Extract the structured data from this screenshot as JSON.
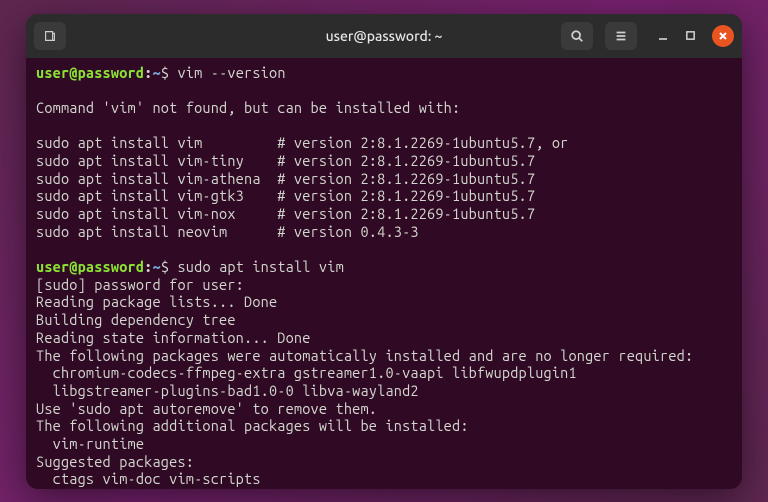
{
  "window": {
    "title": "user@password: ~"
  },
  "prompt": {
    "userhost": "user@password",
    "colon": ":",
    "path": "~",
    "symbol": "$"
  },
  "commands": {
    "cmd1": "vim --version",
    "cmd2": "sudo apt install vim"
  },
  "output": {
    "notfound": "Command 'vim' not found, but can be installed with:",
    "sugg1": "sudo apt install vim         # version 2:8.1.2269-1ubuntu5.7, or",
    "sugg2": "sudo apt install vim-tiny    # version 2:8.1.2269-1ubuntu5.7",
    "sugg3": "sudo apt install vim-athena  # version 2:8.1.2269-1ubuntu5.7",
    "sugg4": "sudo apt install vim-gtk3    # version 2:8.1.2269-1ubuntu5.7",
    "sugg5": "sudo apt install vim-nox     # version 2:8.1.2269-1ubuntu5.7",
    "sugg6": "sudo apt install neovim      # version 0.4.3-3",
    "sudopw": "[sudo] password for user:",
    "read1": "Reading package lists... Done",
    "build1": "Building dependency tree",
    "read2": "Reading state information... Done",
    "auto1": "The following packages were automatically installed and are no longer required:",
    "auto2": "  chromium-codecs-ffmpeg-extra gstreamer1.0-vaapi libfwupdplugin1",
    "auto3": "  libgstreamer-plugins-bad1.0-0 libva-wayland2",
    "auto4": "Use 'sudo apt autoremove' to remove them.",
    "addpkg1": "The following additional packages will be installed:",
    "addpkg2": "  vim-runtime",
    "suggpkg1": "Suggested packages:",
    "suggpkg2": "  ctags vim-doc vim-scripts"
  }
}
